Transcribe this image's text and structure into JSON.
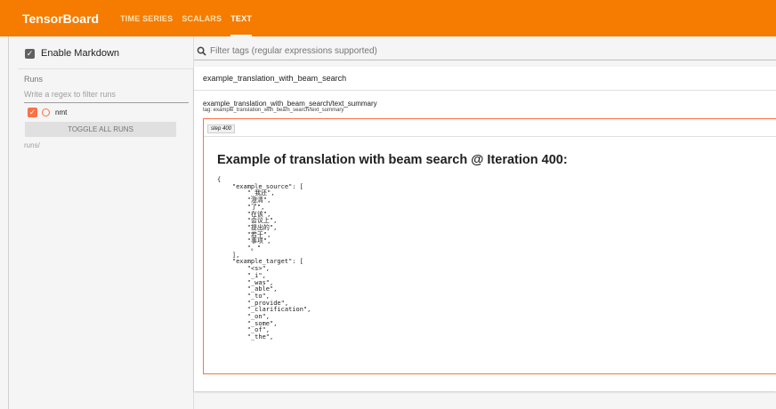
{
  "app": {
    "title": "TensorBoard"
  },
  "tabs": [
    {
      "label": "TIME SERIES"
    },
    {
      "label": "SCALARS"
    },
    {
      "label": "TEXT"
    }
  ],
  "sidebar": {
    "markdown_label": "Enable Markdown",
    "runs_title": "Runs",
    "regex_placeholder": "Write a regex to filter runs",
    "run": {
      "name": "nmt"
    },
    "toggle_label": "TOGGLE ALL RUNS",
    "runs_path": "runs/"
  },
  "filter": {
    "placeholder": "Filter tags (regular expressions supported)"
  },
  "card": {
    "header": "example_translation_with_beam_search",
    "summary_name": "example_translation_with_beam_search/text_summary",
    "summary_tag": "tag: example_translation_with_beam_search/text_summary",
    "step": "step 400",
    "heading": "Example of translation with beam search @ Iteration 400:",
    "code": "{\n    \"example_source\": [\n        \"_我还\",\n        \"澄清\",\n        \"了\",\n        \"在该\",\n        \"会议上\",\n        \"提出的\",\n        \"若干\",\n        \"事项\",\n        \"。\"\n    ],\n    \"example_target\": [\n        \"<s>\",\n        \"_i\",\n        \"_was\",\n        \"_able\",\n        \"_to\",\n        \"_provide\",\n        \"_clarification\",\n        \"_on\",\n        \"_some\",\n        \"_of\",\n        \"_the\","
  },
  "colors": {
    "brand": "#f57c00",
    "accent": "#ff7043"
  }
}
